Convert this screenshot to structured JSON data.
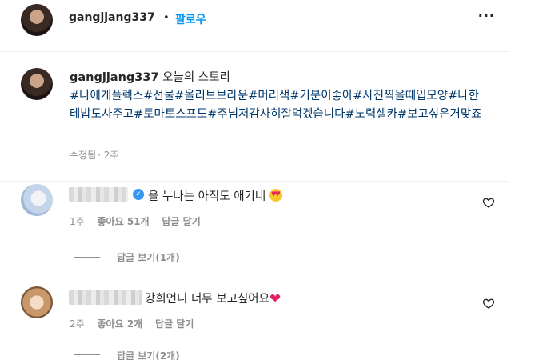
{
  "post": {
    "username": "gangjjang337",
    "separator": "•",
    "follow_label": "팔로우",
    "more_label": "···"
  },
  "caption": {
    "username": "gangjjang337",
    "title": "오늘의 스토리",
    "hashtags": "#나에게플렉스#선물#올리브브라운#머리색#기분이좋아#사진찍을때입모양#나한테밥도사주고#토마토스프도#주님저감사히잘먹겠습니다#노력셀카#보고싶은거맞죠",
    "edited": "수정됨",
    "age": "· 2주"
  },
  "comments": [
    {
      "username_hidden": true,
      "verified": true,
      "text": "을 누나는 아직도 애기네",
      "emoji": "heart-eyes",
      "age": "1주",
      "likes": "좋아요 51개",
      "reply_label": "답글 달기",
      "view_replies": "답글 보기(1개)"
    },
    {
      "username_hidden": true,
      "verified": false,
      "text": "강희언니 너무 보고싶어요",
      "emoji": "❤",
      "age": "2주",
      "likes": "좋아요 2개",
      "reply_label": "답글 달기",
      "view_replies": "답글 보기(2개)"
    }
  ],
  "colors": {
    "follow": "#0095f6",
    "hashtag": "#00376b",
    "muted": "#8e8e8e",
    "verified": "#3897f0"
  }
}
